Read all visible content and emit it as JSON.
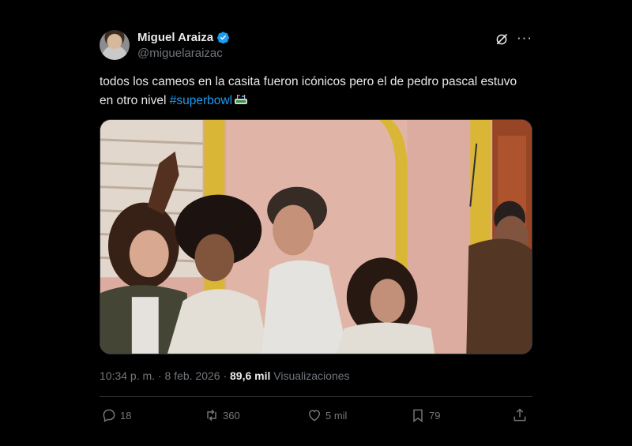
{
  "author": {
    "display_name": "Miguel Araiza",
    "handle": "@miguelaraizac",
    "verified": true
  },
  "tweet": {
    "text_part1": "todos los cameos en la casita fueron icónicos pero el de pedro pascal estuvo en otro nivel ",
    "hashtag": "#superbowl"
  },
  "meta": {
    "time": "10:34 p. m.",
    "separator1": " · ",
    "date": "8 feb. 2026",
    "separator2": " · ",
    "views_count": "89,6 mil",
    "views_label": " Visualizaciones"
  },
  "actions": {
    "replies": "18",
    "reposts": "360",
    "likes": "5 mil",
    "bookmarks": "79"
  },
  "colors": {
    "background": "#000000",
    "text": "#e7e9ea",
    "secondary": "#71767b",
    "link": "#1d9bf0",
    "border": "#2f3336"
  }
}
